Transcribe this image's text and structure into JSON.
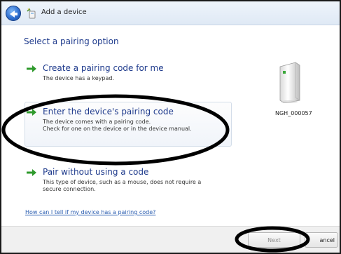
{
  "window": {
    "title": "Add a device"
  },
  "heading": "Select a pairing option",
  "options": [
    {
      "title": "Create a pairing code for me",
      "desc": "The device has a keypad."
    },
    {
      "title": "Enter the device's pairing code",
      "desc_line1": "The device comes with a pairing code.",
      "desc_line2": "Check for one on the device or in the device manual."
    },
    {
      "title": "Pair without using a code",
      "desc_line1": "This type of device, such as a mouse, does not require a",
      "desc_line2": "secure connection."
    }
  ],
  "device": {
    "name": "NGH_000057"
  },
  "help_link": "How can I tell if my device has a pairing code?",
  "buttons": {
    "next": "Next",
    "cancel": "ancel"
  }
}
